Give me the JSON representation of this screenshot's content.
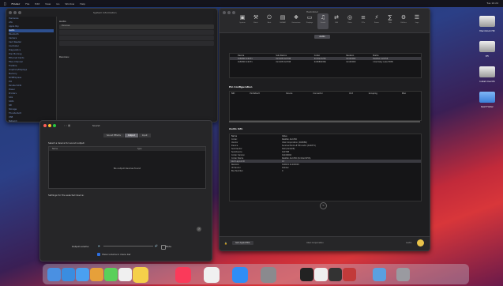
{
  "menubar": {
    "items": [
      "Finder",
      "File",
      "Edit",
      "View",
      "Go",
      "Window",
      "Help"
    ],
    "right_text": "Tue 10:24"
  },
  "window_left": {
    "title": "System Information",
    "sidebar_items": [
      "Hardware",
      "ATA",
      "Apple Pay",
      "Audio",
      "Bluetooth",
      "Camera",
      "Card Reader",
      "Controller",
      "Diagnostics",
      "Disc Burning",
      "Ethernet Cards",
      "Fibre Channel",
      "FireWire",
      "Graphics/Displays",
      "Memory",
      "NVMExpress",
      "PCI",
      "Parallel SCSI",
      "Power",
      "Printers",
      "SAS",
      "SATA",
      "SPI",
      "Storage",
      "Thunderbolt",
      "USB",
      "Network",
      "Firewall",
      "Locations",
      "Volumes",
      "WWAN",
      "Wi-Fi",
      "Software",
      "Accessibility",
      "Applications",
      "Developer",
      "Disabled Software"
    ],
    "main_header": "Audio",
    "main_rows": [
      "Devices:",
      "",
      "",
      ""
    ],
    "section2": "Devices:"
  },
  "window_sound": {
    "title": "Sound",
    "tabs": [
      "Sound Effects",
      "Output",
      "Input"
    ],
    "active_tab": "Output",
    "heading": "Select a device for sound output:",
    "col_name": "Name",
    "col_type": "Type",
    "empty_text": "No output devices found",
    "settings_text": "Settings for the selected device:",
    "volume_label": "Output volume:",
    "mute_label": "Mute",
    "show_volume": "Show volume in menu bar"
  },
  "window_right": {
    "title": "Hackintool",
    "toolbar": [
      {
        "label": "System",
        "icon": "chip-icon"
      },
      {
        "label": "Patch",
        "icon": "wrench-icon"
      },
      {
        "label": "Boot",
        "icon": "boot-icon"
      },
      {
        "label": "NVRAM",
        "icon": "nvram-icon"
      },
      {
        "label": "Extensions",
        "icon": "puzzle-icon"
      },
      {
        "label": "Displays",
        "icon": "display-icon"
      },
      {
        "label": "Sound",
        "icon": "speaker-icon"
      },
      {
        "label": "USB",
        "icon": "usb-icon"
      },
      {
        "label": "Disks",
        "icon": "disk-icon"
      },
      {
        "label": "PCIe",
        "icon": "pcie-icon"
      },
      {
        "label": "Power",
        "icon": "power-icon"
      },
      {
        "label": "Calc",
        "icon": "calc-icon"
      },
      {
        "label": "Utilities",
        "icon": "tools-icon"
      },
      {
        "label": "Logs",
        "icon": "log-icon"
      }
    ],
    "segment_label": "Audio",
    "device_table": {
      "headers": [
        "",
        "Device",
        "Sub-Device",
        "Codec",
        "Revision",
        "Name"
      ],
      "rows": [
        [
          "",
          "0x8086 0x9d71",
          "0x1028 0x0798",
          "0x10ec0256",
          "0x100002",
          "Realtek ALC256"
        ],
        [
          "",
          "0x8086 0x9d71",
          "0x1028 0x0798",
          "0x8086280b",
          "0x100000",
          "Intel Kaby Lake HDMI"
        ]
      ]
    },
    "pin_section": "Pin Configuration",
    "pin_headers": [
      "NID",
      "PinDefault",
      "Device",
      "Connector",
      "Port",
      "Grouping",
      "Misc"
    ],
    "audio_info_section": "Audio Info",
    "audio_info": [
      {
        "k": "Name",
        "v": "Value"
      },
      {
        "k": "Codec",
        "v": "Realtek ALC256"
      },
      {
        "k": "Vendor",
        "v": "Intel Corporation (0x8086)"
      },
      {
        "k": "Device",
        "v": "Sunrise Point-LP HD Audio (0x9d71)"
      },
      {
        "k": "Sub-Vendor",
        "v": "Dell (0x1028)"
      },
      {
        "k": "Sub-Device",
        "v": "0x0798"
      },
      {
        "k": "Codec Version",
        "v": "0x100002"
      },
      {
        "k": "Codec Name",
        "v": "Realtek ALC256 (0x10ec0256)"
      },
      {
        "k": "ALC Layout ID",
        "v": "13"
      },
      {
        "k": "Revision",
        "v": "0x0021 0x100002"
      },
      {
        "k": "ID Vendor",
        "v": "0x10ec"
      },
      {
        "k": "Bus Number",
        "v": "0"
      }
    ],
    "footer_left": "Get AppleHDA",
    "footer_mid": "Intel Corporation",
    "footer_right": "Audio"
  },
  "desktop_icons": [
    {
      "label": "Macintosh HD"
    },
    {
      "label": "EFI"
    },
    {
      "label": "Install macOS"
    },
    {
      "label": "Kext Folder"
    }
  ],
  "dock": {
    "apps": [
      "Finder",
      "Safari",
      "Mail",
      "Photos",
      "Messages",
      "Calendar",
      "Notes",
      "Music",
      "Screenshot",
      "App Store",
      "System Preferences",
      "Terminal",
      "TextEdit",
      "Console",
      "Hackintool",
      "Downloads",
      "Trash"
    ]
  }
}
